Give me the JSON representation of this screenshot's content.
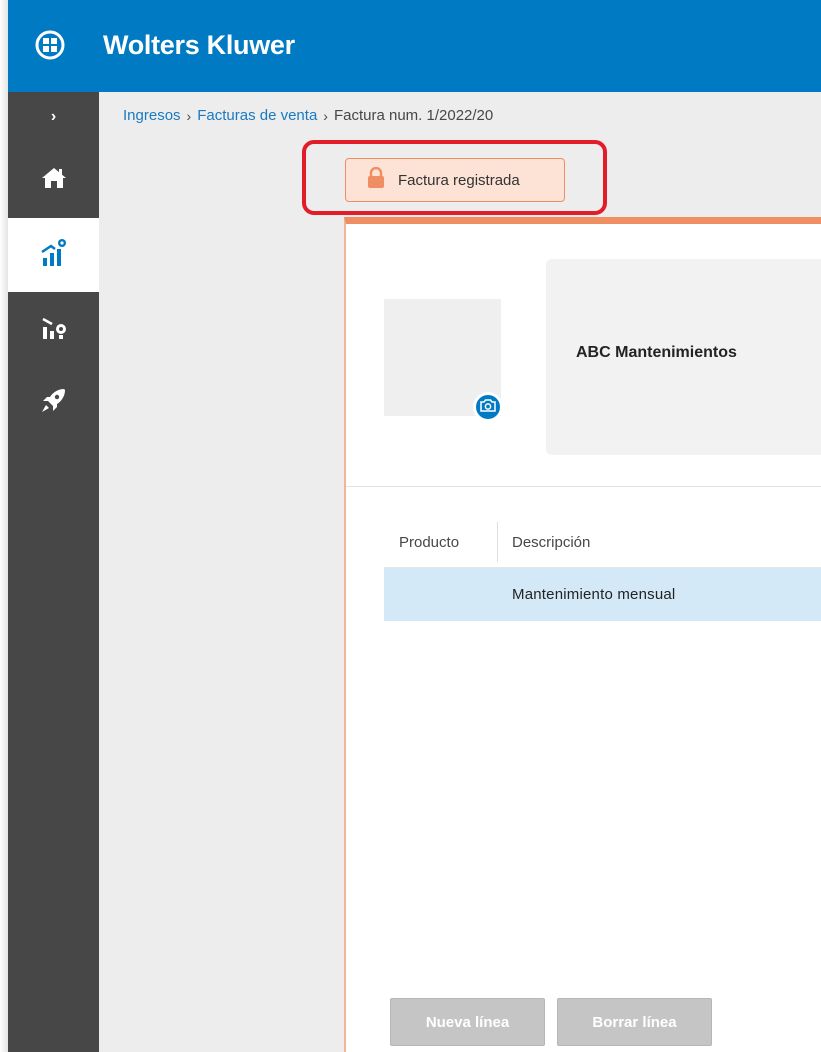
{
  "app": {
    "title": "Wolters Kluwer",
    "brand_color": "#007ac3"
  },
  "sidebar": {
    "items": [
      {
        "icon": "chevron-right-icon",
        "label": "›"
      },
      {
        "icon": "home-icon"
      },
      {
        "icon": "income-chart-icon",
        "active": true
      },
      {
        "icon": "expenses-chart-icon"
      },
      {
        "icon": "rocket-icon"
      }
    ]
  },
  "breadcrumb": {
    "items": [
      {
        "label": "Ingresos",
        "link": true
      },
      {
        "label": "Facturas de venta",
        "link": true
      },
      {
        "label": "Factura num. 1/2022/20",
        "link": false
      }
    ],
    "separator": "›"
  },
  "status": {
    "label": "Factura registrada",
    "icon": "lock-icon",
    "color": "#f08e63"
  },
  "invoice": {
    "company_name": "ABC Mantenimientos",
    "logo_placeholder_icon": "camera-icon",
    "table": {
      "columns": [
        "Producto",
        "Descripción"
      ],
      "rows": [
        {
          "product": "",
          "description": "Mantenimiento mensual"
        }
      ]
    }
  },
  "actions": {
    "new_line": "Nueva línea",
    "delete_line": "Borrar línea"
  },
  "colors": {
    "sidebar_bg": "#474747",
    "highlight": "#e21d2a",
    "row_selected": "#d4e9f7"
  }
}
